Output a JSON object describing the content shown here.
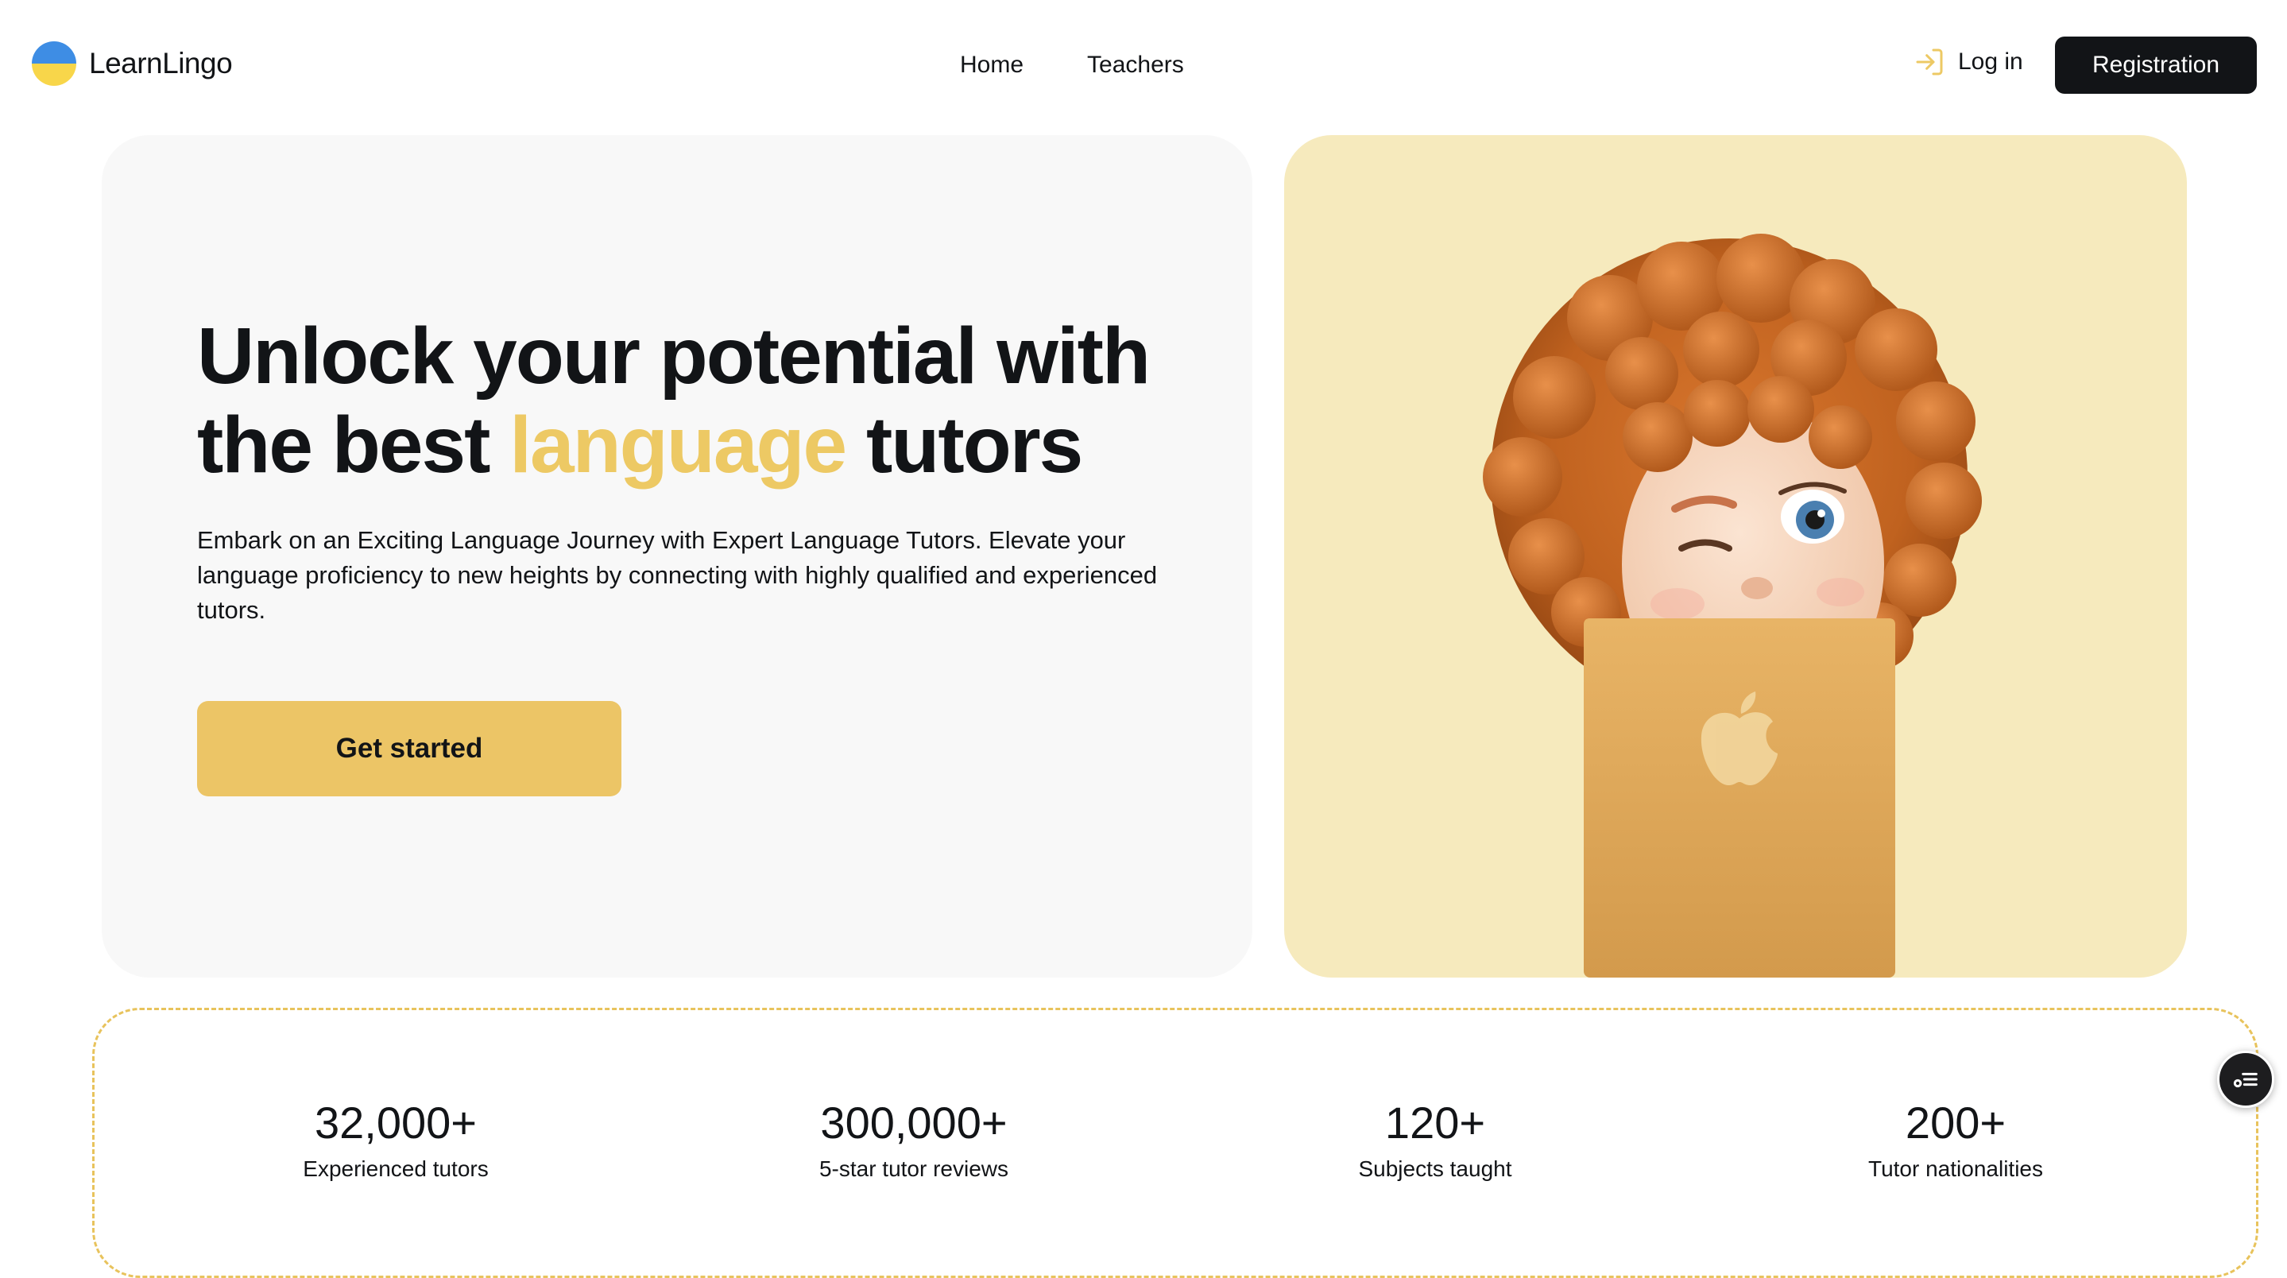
{
  "brand": {
    "name": "LearnLingo",
    "logo_icon": "ukraine-flag-icon"
  },
  "nav": {
    "items": [
      {
        "label": "Home"
      },
      {
        "label": "Teachers"
      }
    ]
  },
  "auth": {
    "login_label": "Log in",
    "login_icon": "login-arrow-icon",
    "register_label": "Registration"
  },
  "hero": {
    "title_part1": "Unlock your potential with the best ",
    "title_accent": "language",
    "title_part2": " tutors",
    "description": "Embark on an Exciting Language Journey with Expert Language Tutors. Elevate your language proficiency to new heights by connecting with highly qualified and experienced tutors.",
    "cta_label": "Get started",
    "image_subject": "curly-haired memoji winking over laptop"
  },
  "stats": [
    {
      "value": "32,000+",
      "label": "Experienced tutors"
    },
    {
      "value": "300,000+",
      "label": "5-star tutor reviews"
    },
    {
      "value": "120+",
      "label": "Subjects taught"
    },
    {
      "value": "200+",
      "label": "Tutor nationalities"
    }
  ],
  "widget": {
    "icon": "menu-list-icon"
  },
  "colors": {
    "accent": "#edc964",
    "button_yellow": "#ecc566",
    "dark": "#121417",
    "hero_left_bg": "#f8f8f8",
    "hero_right_bg": "#f6eabd",
    "flag_blue": "#3e8de4",
    "flag_yellow": "#f8d64a"
  }
}
